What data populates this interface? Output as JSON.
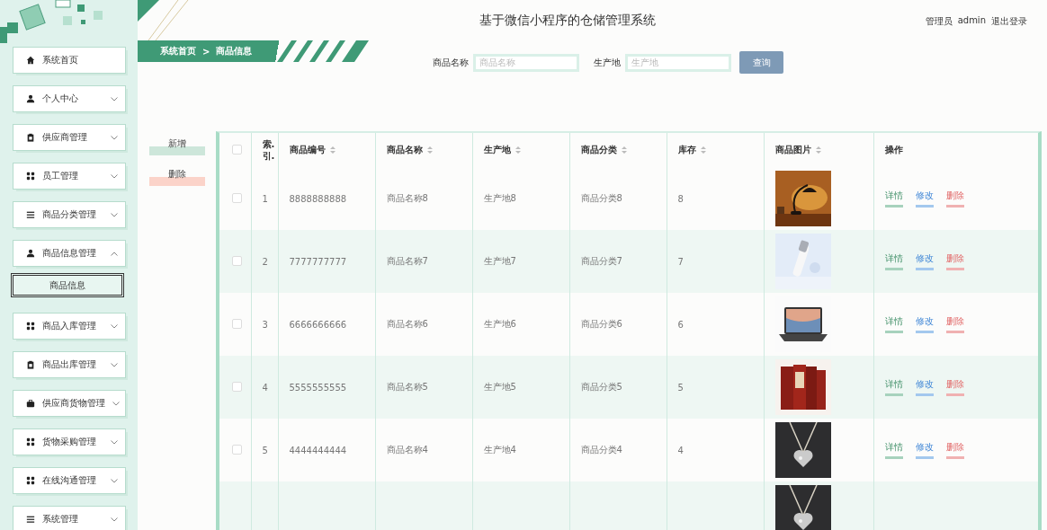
{
  "header": {
    "title": "基于微信小程序的仓储管理系统",
    "user_role": "管理员",
    "user_name": "admin",
    "logout": "退出登录"
  },
  "sidebar": {
    "items": [
      {
        "label": "系统首页",
        "kind": "link"
      },
      {
        "label": "个人中心",
        "kind": "menu",
        "expanded": false
      },
      {
        "label": "供应商管理",
        "kind": "menu",
        "expanded": false
      },
      {
        "label": "员工管理",
        "kind": "menu",
        "expanded": false
      },
      {
        "label": "商品分类管理",
        "kind": "menu",
        "expanded": false
      },
      {
        "label": "商品信息管理",
        "kind": "menu",
        "expanded": true,
        "children": [
          {
            "label": "商品信息",
            "selected": true
          }
        ]
      },
      {
        "label": "商品入库管理",
        "kind": "menu",
        "expanded": false
      },
      {
        "label": "商品出库管理",
        "kind": "menu",
        "expanded": false
      },
      {
        "label": "供应商货物管理",
        "kind": "menu",
        "expanded": false
      },
      {
        "label": "货物采购管理",
        "kind": "menu",
        "expanded": false
      },
      {
        "label": "在线沟通管理",
        "kind": "menu",
        "expanded": false
      },
      {
        "label": "系统管理",
        "kind": "menu",
        "expanded": false
      }
    ]
  },
  "breadcrumb": {
    "home": "系统首页",
    "separator": ">",
    "current": "商品信息"
  },
  "search": {
    "fields": [
      {
        "label": "商品名称",
        "placeholder": "商品名称"
      },
      {
        "label": "生产地",
        "placeholder": "生产地"
      }
    ],
    "button": "查询"
  },
  "actions": {
    "add": "新增",
    "delete": "删除"
  },
  "table": {
    "select_all_checked": false,
    "columns": [
      {
        "label": "索.\n引.",
        "sortable": false
      },
      {
        "label": "商品编号",
        "sortable": true
      },
      {
        "label": "商品名称",
        "sortable": true
      },
      {
        "label": "生产地",
        "sortable": true
      },
      {
        "label": "商品分类",
        "sortable": true
      },
      {
        "label": "库存",
        "sortable": true
      },
      {
        "label": "商品图片",
        "sortable": true
      },
      {
        "label": "操作",
        "sortable": false
      }
    ],
    "rows": [
      {
        "index": "1",
        "code": "8888888888",
        "name": "商品名称8",
        "origin": "生产地8",
        "category": "商品分类8",
        "stock": "8",
        "checked": false,
        "actions": [
          {
            "label": "详情",
            "kind": "detail"
          },
          {
            "label": "修改",
            "kind": "edit"
          },
          {
            "label": "删除",
            "kind": "delete"
          }
        ]
      },
      {
        "index": "2",
        "code": "7777777777",
        "name": "商品名称7",
        "origin": "生产地7",
        "category": "商品分类7",
        "stock": "7",
        "checked": false,
        "actions": [
          {
            "label": "详情",
            "kind": "detail"
          },
          {
            "label": "修改",
            "kind": "edit"
          },
          {
            "label": "删除",
            "kind": "delete"
          }
        ]
      },
      {
        "index": "3",
        "code": "6666666666",
        "name": "商品名称6",
        "origin": "生产地6",
        "category": "商品分类6",
        "stock": "6",
        "checked": false,
        "actions": [
          {
            "label": "详情",
            "kind": "detail"
          },
          {
            "label": "修改",
            "kind": "edit"
          },
          {
            "label": "删除",
            "kind": "delete"
          }
        ]
      },
      {
        "index": "4",
        "code": "5555555555",
        "name": "商品名称5",
        "origin": "生产地5",
        "category": "商品分类5",
        "stock": "5",
        "checked": false,
        "actions": [
          {
            "label": "详情",
            "kind": "detail"
          },
          {
            "label": "修改",
            "kind": "edit"
          },
          {
            "label": "删除",
            "kind": "delete"
          }
        ]
      },
      {
        "index": "5",
        "code": "4444444444",
        "name": "商品名称4",
        "origin": "生产地4",
        "category": "商品分类4",
        "stock": "4",
        "checked": false,
        "actions": [
          {
            "label": "详情",
            "kind": "detail"
          },
          {
            "label": "修改",
            "kind": "edit"
          },
          {
            "label": "删除",
            "kind": "delete"
          }
        ]
      }
    ]
  }
}
